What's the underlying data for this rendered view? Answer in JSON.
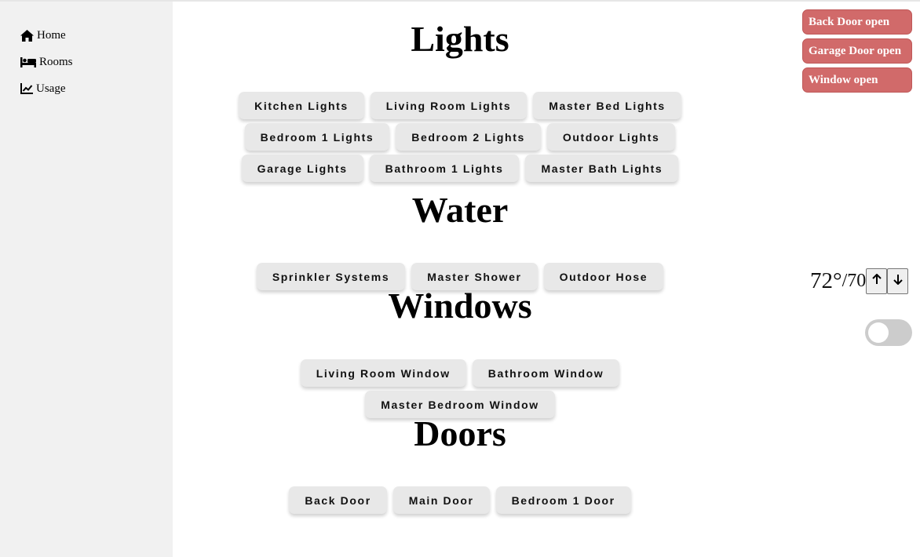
{
  "sidebar": {
    "items": [
      {
        "label": "Home",
        "icon": "home-icon"
      },
      {
        "label": "Rooms",
        "icon": "bed-icon"
      },
      {
        "label": "Usage",
        "icon": "chart-line-icon"
      }
    ]
  },
  "sections": {
    "lights": {
      "title": "Lights",
      "buttons": [
        "Kitchen Lights",
        "Living Room Lights",
        "Master Bed Lights",
        "Bedroom 1 Lights",
        "Bedroom 2 Lights",
        "Outdoor Lights",
        "Garage Lights",
        "Bathroom 1 Lights",
        "Master Bath Lights"
      ]
    },
    "water": {
      "title": "Water",
      "buttons": [
        "Sprinkler Systems",
        "Master Shower",
        "Outdoor Hose"
      ]
    },
    "windows": {
      "title": "Windows",
      "buttons": [
        "Living Room Window",
        "Bathroom Window",
        "Master Bedroom Window"
      ]
    },
    "doors": {
      "title": "Doors",
      "buttons": [
        "Back Door",
        "Main Door",
        "Bedroom 1 Door"
      ]
    }
  },
  "alerts": [
    "Back Door open",
    "Garage Door open",
    "Window open"
  ],
  "thermostat": {
    "current": "72°",
    "separator": "/",
    "target": "70",
    "up_icon": "arrow-up-icon",
    "down_icon": "arrow-down-icon"
  },
  "toggle": {
    "on": false
  },
  "colors": {
    "sidebar_bg": "#f1f1f1",
    "button_bg": "#e8e8e8",
    "alert_bg": "#d16a6a",
    "toggle_off": "#cccccc"
  }
}
